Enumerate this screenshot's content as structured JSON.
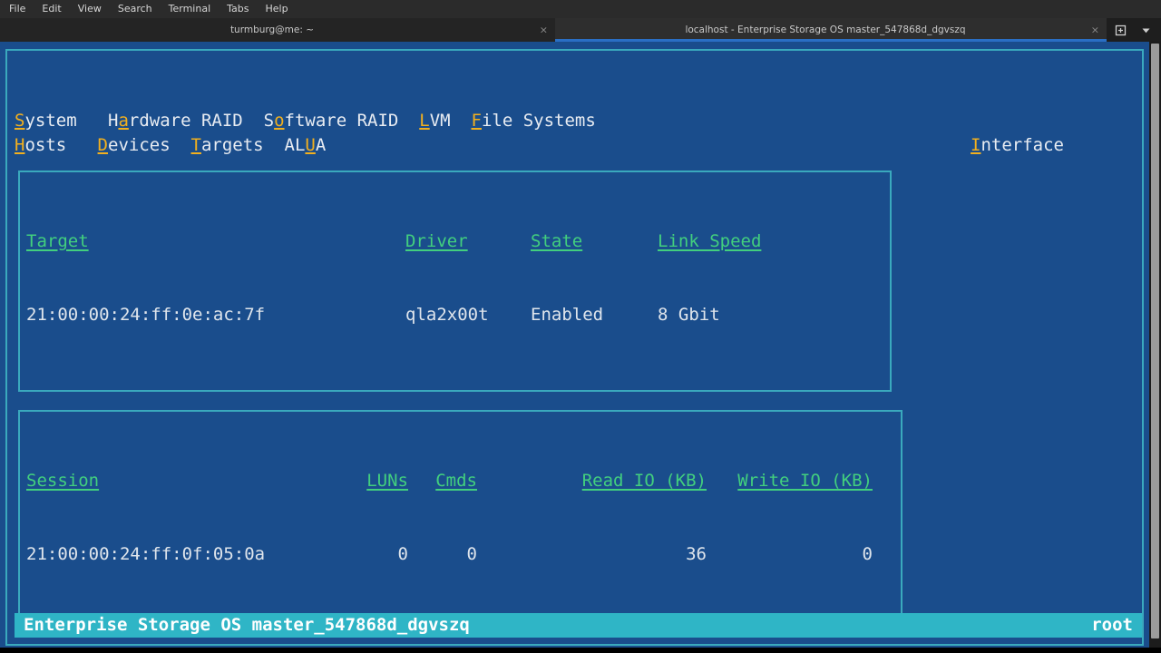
{
  "window": {
    "menubar": [
      "File",
      "Edit",
      "View",
      "Search",
      "Terminal",
      "Tabs",
      "Help"
    ],
    "tabs": [
      {
        "title": "turmburg@me: ~",
        "close": "×",
        "active": false
      },
      {
        "title": "localhost - Enterprise Storage OS master_547868d_dgvszq",
        "close": "×",
        "active": true
      }
    ],
    "tools": {
      "new_tab": "new-tab-icon",
      "tab_list": "chevron-down-icon"
    }
  },
  "tui": {
    "menu_rows": [
      [
        {
          "accel": "S",
          "rest": "ystem"
        },
        {
          "accel": "",
          "pre": "H",
          "mid": "a",
          "rest": "rdware RAID",
          "split": true
        },
        {
          "accel": "",
          "pre": "S",
          "mid": "o",
          "rest": "ftware RAID",
          "split": true
        },
        {
          "accel": "L",
          "rest": "VM"
        },
        {
          "accel": "F",
          "rest": "ile Systems"
        }
      ],
      [
        {
          "accel": "H",
          "rest": "osts"
        },
        {
          "accel": "D",
          "rest": "evices"
        },
        {
          "accel": "T",
          "rest": "argets"
        },
        {
          "accel": "",
          "pre": "AL",
          "mid": "U",
          "rest": "A",
          "split": true
        }
      ]
    ],
    "menu_labels": {
      "system": "System",
      "hardware_raid": "Hardware RAID",
      "software_raid": "Software RAID",
      "lvm": "LVM",
      "file_systems": "File Systems",
      "hosts": "Hosts",
      "devices": "Devices",
      "targets": "Targets",
      "alua": "ALUA",
      "interface": "Interface"
    },
    "menu_accels": {
      "system": "S",
      "hardware_raid_pre": "H",
      "hardware_raid_accel": "a",
      "hardware_raid_post": "rdware RAID",
      "software_raid_pre": "S",
      "software_raid_accel": "o",
      "software_raid_post": "ftware RAID",
      "lvm": "L",
      "lvm_post": "VM",
      "file_systems": "F",
      "file_systems_post": "ile Systems",
      "hosts": "H",
      "hosts_post": "osts",
      "devices": "D",
      "devices_post": "evices",
      "targets": "T",
      "targets_post": "argets",
      "alua_pre": "AL",
      "alua_accel": "U",
      "alua_post": "A",
      "interface": "I",
      "interface_post": "nterface",
      "system_post": "ystem"
    },
    "targets_panel": {
      "headers": [
        "Target",
        "Driver",
        "State",
        "Link Speed"
      ],
      "rows": [
        {
          "target": "21:00:00:24:ff:0e:ac:7f",
          "driver": "qla2x00t",
          "state": "Enabled",
          "link_speed": "8 Gbit"
        }
      ]
    },
    "sessions_panel": {
      "headers": [
        "Session",
        "LUNs",
        "Cmds",
        "Read IO (KB)",
        "Write IO (KB)"
      ],
      "rows": [
        {
          "session": "21:00:00:24:ff:0f:05:0a",
          "luns": "0",
          "cmds": "0",
          "read_io_kb": "36",
          "write_io_kb": "0"
        }
      ]
    },
    "statusbar": {
      "left": "Enterprise Storage OS master_547868d_dgvszq",
      "right": "root"
    }
  },
  "colors": {
    "background_blue": "#1a4d8c",
    "border_cyan": "#3aa9bd",
    "header_green": "#42cf7e",
    "accel_yellow": "#f2b01e",
    "status_cyan": "#2fb5c6",
    "text_white": "#e8ecf2"
  }
}
